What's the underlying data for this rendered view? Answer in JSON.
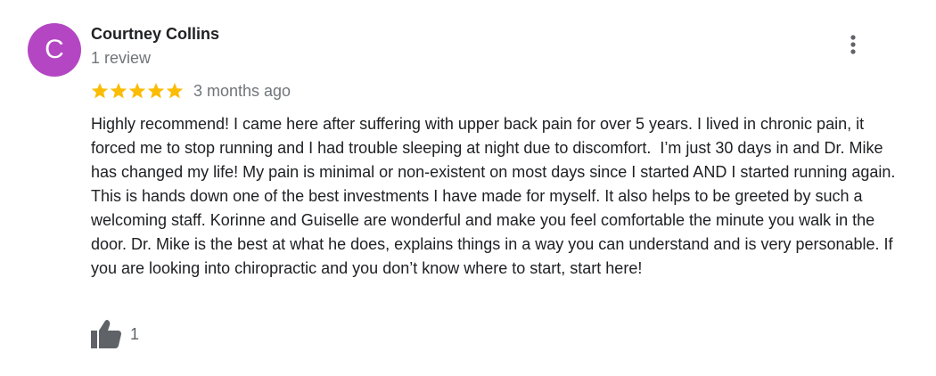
{
  "reviewer": {
    "initial": "C",
    "name": "Courtney Collins",
    "review_count": "1 review",
    "avatar_color": "#b446c4"
  },
  "rating": {
    "stars": 5,
    "max_stars": 5,
    "star_color": "#fbbc04",
    "date": "3 months ago"
  },
  "review_text": "Highly recommend! I came here after suffering with upper back pain for over 5 years. I lived in chronic pain, it forced me to stop running and I had trouble sleeping at night due to discomfort.  I’m just 30 days in and Dr. Mike has changed my life! My pain is minimal or non-existent on most days since I started AND I started running again. This is hands down one of the best investments I have made for myself. It also helps to be greeted by such a welcoming staff. Korinne and Guiselle are wonderful and make you feel comfortable the minute you walk in the door. Dr. Mike is the best at what he does, explains things in a way you can understand and is very personable. If you are looking into chiropractic and you don’t know where to start, start here!",
  "actions": {
    "like_count": "1",
    "like_icon": "thumbs-up-icon",
    "more_icon": "more-vert-icon"
  }
}
